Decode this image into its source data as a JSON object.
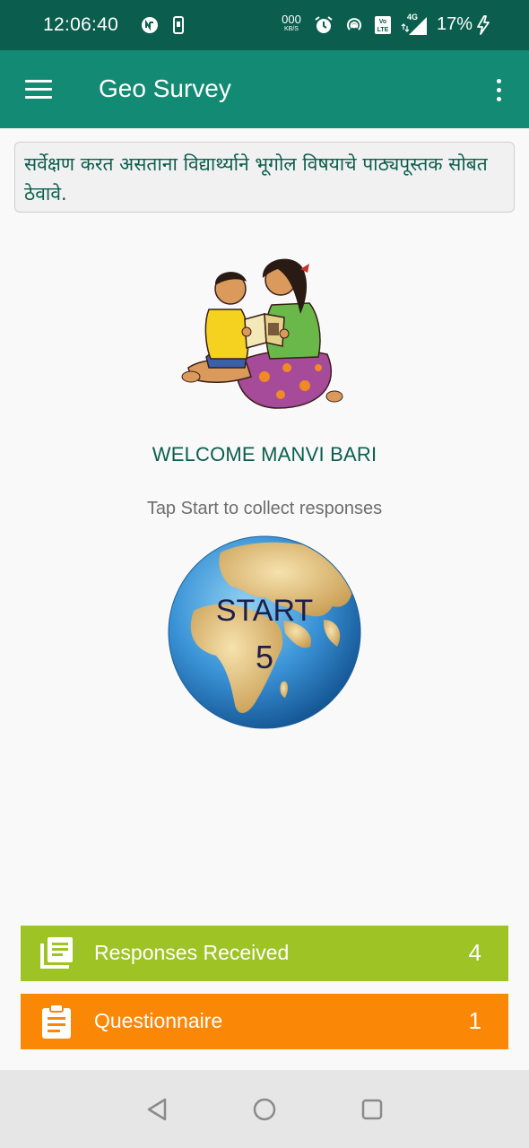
{
  "status_bar": {
    "time": "12:06:40",
    "net_speed_value": "000",
    "net_speed_unit": "KB/S",
    "network_type": "4G",
    "volte_label": "Vo LTE",
    "battery_percent": "17%",
    "icons": [
      "sync-icon",
      "phone-icon",
      "alarm-icon",
      "hotspot-icon",
      "volte-icon",
      "signal-icon",
      "charging-icon"
    ]
  },
  "app_bar": {
    "title": "Geo Survey",
    "icons": [
      "menu-icon",
      "overflow-icon"
    ]
  },
  "notice": {
    "text": "सर्वेक्षण करत असताना विद्यार्थ्याने भूगोल विषयाचे पाठ्यपूस्तक सोबत ठेवावे."
  },
  "welcome": {
    "text": "WELCOME MANVI BARI",
    "hint": "Tap Start to collect responses"
  },
  "start": {
    "label": "START",
    "count": "5"
  },
  "cards": [
    {
      "label": "Responses Received",
      "count": "4",
      "icon": "responses-icon",
      "color": "#9ec324"
    },
    {
      "label": "Questionnaire",
      "count": "1",
      "icon": "clipboard-icon",
      "color": "#fb8707"
    }
  ],
  "colors": {
    "status_bar": "#0b5e4e",
    "app_bar": "#138a73",
    "accent_text": "#0b5e4e"
  },
  "nav_bar": {
    "icons": [
      "back-icon",
      "home-icon",
      "recents-icon"
    ]
  }
}
